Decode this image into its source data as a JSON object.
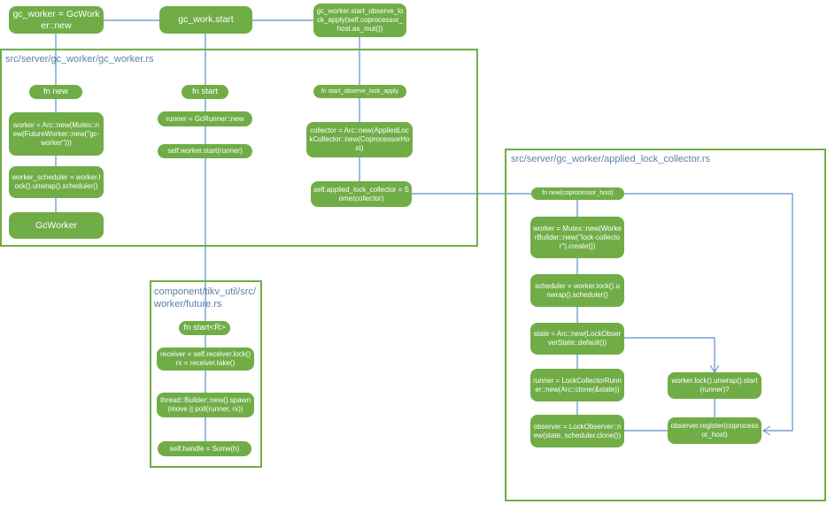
{
  "colors": {
    "node_fill": "#70ad47",
    "frame_border": "#70ad47",
    "connector": "#5b8fc9",
    "frame_title": "#5b7fa8"
  },
  "top": {
    "gc_worker_new": "gc_worker = GcWorker::new",
    "gc_work_start": "gc_work.start",
    "start_observe_call": "gc_worker.start_observe_lock_apply(self.coprocessor_host.as_mut())"
  },
  "gc_worker_rs": {
    "title": "src/server/gc_worker/gc_worker.rs",
    "fn_new": {
      "label": "fn new",
      "steps": [
        "worker = Arc::new(Mutex::new(FutureWorker::new(\"gc-worker\")))",
        "worker_scheduler = worker.lock().unwrap().scheduler()",
        "GcWorker"
      ]
    },
    "fn_start": {
      "label": "fn start",
      "steps": [
        "runner = GcRunner::new",
        "self.worker.start(runner)"
      ]
    },
    "fn_start_observe": {
      "label": "fn start_observe_lock_apply",
      "steps": [
        "collector = Arc::new(AppliedLockCollector::new(CoprocessorHost)",
        "self.applied_lock_collector = Some(collector)"
      ]
    }
  },
  "future_rs": {
    "title": "component/tikv_util/src/worker/future.rs",
    "fn_label": "fn start<R>",
    "steps": [
      "receiver = self.receiver.lock() rx = receiver.take()",
      "thread::Builder::new().spawn(move || poll(runner, rx))",
      "self.handle = Some(h)"
    ]
  },
  "collector_rs": {
    "title": "src/server/gc_worker/applied_lock_collector.rs",
    "fn_label": "fn new(coprocessor_host)",
    "steps": [
      "worker = Mutex::new(WorkerBuilder::new(\"lock-collector\").create())",
      "scheduler = worker.lock().unwrap().scheduler()",
      "state = Arc::new(LockObserverState::default())",
      "runner = LockCollectorRunner::new(Arc::clone(&state))",
      "observer = LockObserver::new(state, scheduler.clone())"
    ],
    "side_steps": [
      "worker.lock().unwrap().start(runner)?",
      "observer.register(coprocessor_host)"
    ]
  }
}
